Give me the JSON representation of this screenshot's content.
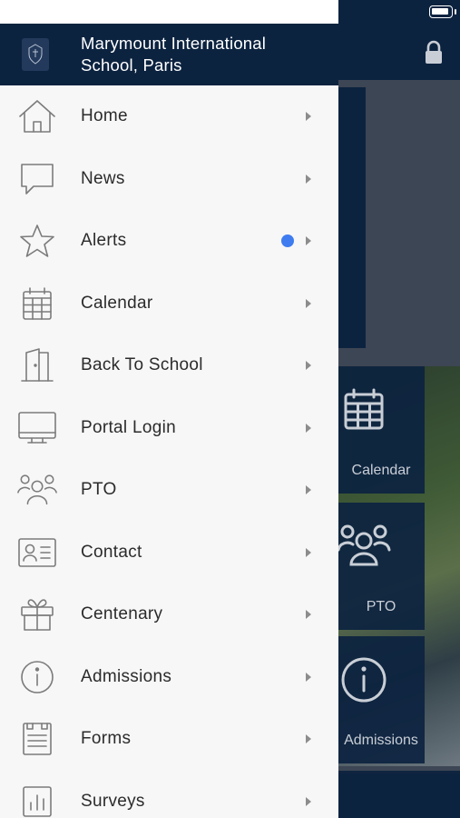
{
  "drawer": {
    "school_name": "Marymount International School, Paris",
    "logo_text": "Marymount",
    "items": [
      {
        "label": "Home",
        "icon": "home-icon"
      },
      {
        "label": "News",
        "icon": "speech-bubble-icon"
      },
      {
        "label": "Alerts",
        "icon": "star-icon",
        "has_unread": true
      },
      {
        "label": "Calendar",
        "icon": "calendar-icon"
      },
      {
        "label": "Back To School",
        "icon": "door-icon"
      },
      {
        "label": "Portal Login",
        "icon": "monitor-icon"
      },
      {
        "label": "PTO",
        "icon": "people-group-icon"
      },
      {
        "label": "Contact",
        "icon": "contact-card-icon"
      },
      {
        "label": "Centenary",
        "icon": "gift-icon"
      },
      {
        "label": "Admissions",
        "icon": "info-icon"
      },
      {
        "label": "Forms",
        "icon": "form-icon"
      },
      {
        "label": "Surveys",
        "icon": "bar-chart-icon"
      }
    ]
  },
  "background": {
    "tiles": [
      {
        "label": "Calendar",
        "icon": "calendar-icon"
      },
      {
        "label": "PTO",
        "icon": "people-group-icon"
      },
      {
        "label": "Admissions",
        "icon": "info-icon"
      }
    ]
  },
  "colors": {
    "brand_navy": "#0c2340",
    "drawer_bg": "#f7f7f7",
    "alert_dot": "#3e7cf0",
    "icon_gray": "#7b7b7b"
  }
}
